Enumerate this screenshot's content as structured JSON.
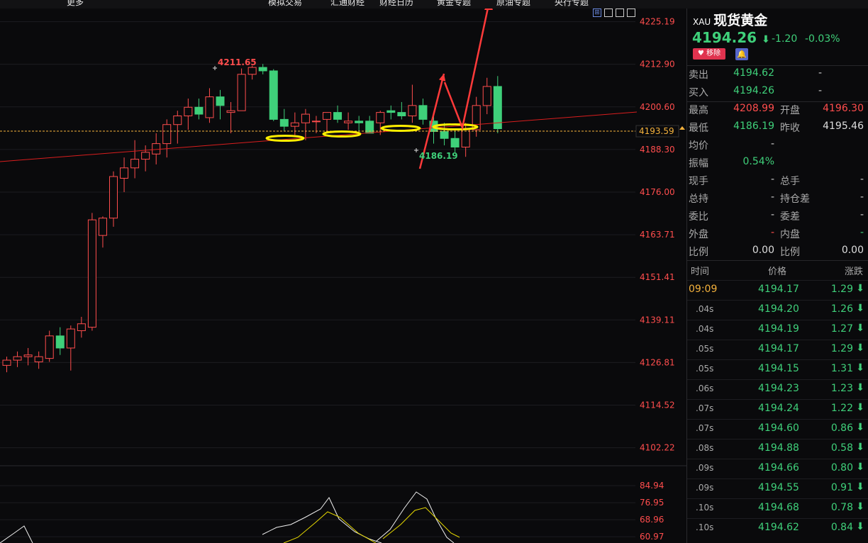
{
  "toolbar": {
    "items": [
      "更多",
      "模拟交易",
      "汇通财经",
      "财经日历",
      "黄金专题",
      "原油专题",
      "央行专题"
    ]
  },
  "chart": {
    "price_labels": [
      "4225.19",
      "4212.90",
      "4200.60",
      "4188.30",
      "4176.00",
      "4163.71",
      "4151.41",
      "4139.11",
      "4126.81",
      "4114.52",
      "4102.22"
    ],
    "current_price_tag": "4193.59",
    "high_label": "4211.65",
    "low_label": "4186.19",
    "indicator_labels": [
      "84.94",
      "76.95",
      "68.96",
      "60.97"
    ],
    "colors": {
      "up": "#ff4d4d",
      "down": "#3fd07a",
      "annotation": "#ffee00",
      "arrow": "#ff3a3a"
    }
  },
  "chart_data": {
    "type": "candlestick",
    "ylim": [
      4096,
      4229
    ],
    "candles": [
      {
        "o": 4126.0,
        "h": 4128.5,
        "l": 4124.0,
        "c": 4127.5
      },
      {
        "o": 4127.5,
        "h": 4130.0,
        "l": 4125.5,
        "c": 4128.5
      },
      {
        "o": 4128.5,
        "h": 4131.0,
        "l": 4126.0,
        "c": 4129.0
      },
      {
        "o": 4127.0,
        "h": 4130.0,
        "l": 4125.0,
        "c": 4128.5
      },
      {
        "o": 4128.0,
        "h": 4136.0,
        "l": 4127.0,
        "c": 4134.5
      },
      {
        "o": 4134.5,
        "h": 4137.0,
        "l": 4129.0,
        "c": 4131.0
      },
      {
        "o": 4131.0,
        "h": 4137.5,
        "l": 4124.5,
        "c": 4136.5
      },
      {
        "o": 4136.0,
        "h": 4140.0,
        "l": 4134.0,
        "c": 4138.0
      },
      {
        "o": 4137.0,
        "h": 4170.0,
        "l": 4136.0,
        "c": 4168.0
      },
      {
        "o": 4163.5,
        "h": 4169.0,
        "l": 4160.0,
        "c": 4168.5
      },
      {
        "o": 4168.5,
        "h": 4182.0,
        "l": 4166.0,
        "c": 4180.5
      },
      {
        "o": 4180.0,
        "h": 4186.0,
        "l": 4176.0,
        "c": 4183.0
      },
      {
        "o": 4183.0,
        "h": 4191.0,
        "l": 4180.0,
        "c": 4185.5
      },
      {
        "o": 4185.5,
        "h": 4189.5,
        "l": 4182.0,
        "c": 4187.5
      },
      {
        "o": 4187.0,
        "h": 4193.0,
        "l": 4184.0,
        "c": 4190.0
      },
      {
        "o": 4190.0,
        "h": 4197.0,
        "l": 4186.0,
        "c": 4195.5
      },
      {
        "o": 4195.5,
        "h": 4199.5,
        "l": 4190.0,
        "c": 4198.0
      },
      {
        "o": 4198.0,
        "h": 4203.0,
        "l": 4194.0,
        "c": 4200.5
      },
      {
        "o": 4200.5,
        "h": 4203.0,
        "l": 4197.0,
        "c": 4198.5
      },
      {
        "o": 4197.5,
        "h": 4206.0,
        "l": 4196.0,
        "c": 4203.5
      },
      {
        "o": 4203.5,
        "h": 4205.5,
        "l": 4197.0,
        "c": 4201.0
      },
      {
        "o": 4199.0,
        "h": 4202.0,
        "l": 4193.0,
        "c": 4199.5
      },
      {
        "o": 4199.5,
        "h": 4211.7,
        "l": 4200.0,
        "c": 4210.0
      },
      {
        "o": 4210.0,
        "h": 4212.5,
        "l": 4208.5,
        "c": 4212.0
      },
      {
        "o": 4212.0,
        "h": 4213.0,
        "l": 4210.0,
        "c": 4211.0
      },
      {
        "o": 4211.0,
        "h": 4211.5,
        "l": 4196.5,
        "c": 4197.0
      },
      {
        "o": 4197.0,
        "h": 4200.0,
        "l": 4193.5,
        "c": 4195.0
      },
      {
        "o": 4195.0,
        "h": 4199.0,
        "l": 4192.5,
        "c": 4196.0
      },
      {
        "o": 4196.0,
        "h": 4200.0,
        "l": 4191.0,
        "c": 4198.5
      },
      {
        "o": 4196.5,
        "h": 4198.0,
        "l": 4193.0,
        "c": 4196.5
      },
      {
        "o": 4197.0,
        "h": 4199.0,
        "l": 4193.5,
        "c": 4199.0
      },
      {
        "o": 4199.0,
        "h": 4201.0,
        "l": 4196.0,
        "c": 4197.0
      },
      {
        "o": 4196.0,
        "h": 4199.0,
        "l": 4194.0,
        "c": 4196.5
      },
      {
        "o": 4196.5,
        "h": 4198.0,
        "l": 4193.5,
        "c": 4196.0
      },
      {
        "o": 4196.5,
        "h": 4198.0,
        "l": 4193.5,
        "c": 4193.0
      },
      {
        "o": 4196.0,
        "h": 4199.5,
        "l": 4192.5,
        "c": 4199.0
      },
      {
        "o": 4199.5,
        "h": 4201.0,
        "l": 4197.0,
        "c": 4199.0
      },
      {
        "o": 4199.0,
        "h": 4202.0,
        "l": 4197.0,
        "c": 4198.0
      },
      {
        "o": 4198.0,
        "h": 4207.0,
        "l": 4196.0,
        "c": 4201.0
      },
      {
        "o": 4201.0,
        "h": 4203.0,
        "l": 4195.5,
        "c": 4197.0
      },
      {
        "o": 4196.5,
        "h": 4198.5,
        "l": 4190.0,
        "c": 4193.5
      },
      {
        "o": 4193.5,
        "h": 4196.0,
        "l": 4189.5,
        "c": 4191.5
      },
      {
        "o": 4191.5,
        "h": 4193.5,
        "l": 4187.5,
        "c": 4189.0
      },
      {
        "o": 4189.0,
        "h": 4196.0,
        "l": 4186.19,
        "c": 4194.0
      },
      {
        "o": 4194.0,
        "h": 4203.5,
        "l": 4192.0,
        "c": 4201.0
      },
      {
        "o": 4201.0,
        "h": 4209.0,
        "l": 4198.5,
        "c": 4206.5
      },
      {
        "o": 4206.5,
        "h": 4209.5,
        "l": 4193.0,
        "c": 4194.3
      }
    ],
    "indicator_ylim": [
      58,
      88
    ]
  },
  "panel": {
    "symbol": "XAU",
    "name": "现货黄金",
    "last": "4194.26",
    "change": "-1.20",
    "change_pct": "-0.03%",
    "remove_label": "移除",
    "rows": [
      {
        "l1": "卖出",
        "v1": "4194.62",
        "c1": "#3fd07a",
        "v2": "-",
        "c2": "#ccc"
      },
      {
        "l1": "买入",
        "v1": "4194.26",
        "c1": "#3fd07a",
        "v2": "-",
        "c2": "#ccc"
      }
    ],
    "stats": [
      {
        "l1": "最高",
        "v1": "4208.99",
        "c1": "#ff4d4d",
        "l2": "开盘",
        "v2": "4196.30",
        "c2": "#ff4d4d"
      },
      {
        "l1": "最低",
        "v1": "4186.19",
        "c1": "#3fd07a",
        "l2": "昨收",
        "v2": "4195.46",
        "c2": "#ddd"
      },
      {
        "l1": "均价",
        "v1": "-",
        "c1": "#ccc",
        "l2": "",
        "v2": "",
        "c2": "#ccc"
      },
      {
        "l1": "振幅",
        "v1": "0.54%",
        "c1": "#3fd07a",
        "l2": "",
        "v2": "",
        "c2": "#ccc"
      },
      {
        "l1": "现手",
        "v1": "-",
        "c1": "#ccc",
        "l2": "总手",
        "v2": "-",
        "c2": "#ccc"
      },
      {
        "l1": "总持",
        "v1": "-",
        "c1": "#ccc",
        "l2": "持仓差",
        "v2": "-",
        "c2": "#ccc"
      },
      {
        "l1": "委比",
        "v1": "-",
        "c1": "#ccc",
        "l2": "委差",
        "v2": "-",
        "c2": "#ccc"
      },
      {
        "l1": "外盘",
        "v1": "-",
        "c1": "#ff4d4d",
        "l2": "内盘",
        "v2": "-",
        "c2": "#3fd07a"
      },
      {
        "l1": "比例",
        "v1": "0.00",
        "c1": "#ddd",
        "l2": "比例",
        "v2": "0.00",
        "c2": "#ddd"
      }
    ],
    "tick_headers": {
      "time": "时间",
      "price": "价格",
      "change": "涨跌"
    },
    "ticks": [
      {
        "t": "09:09",
        "p": "4194.17",
        "c": "1.29"
      },
      {
        "t": ".04s",
        "p": "4194.20",
        "c": "1.26"
      },
      {
        "t": ".04s",
        "p": "4194.19",
        "c": "1.27"
      },
      {
        "t": ".05s",
        "p": "4194.17",
        "c": "1.29"
      },
      {
        "t": ".05s",
        "p": "4194.15",
        "c": "1.31"
      },
      {
        "t": ".06s",
        "p": "4194.23",
        "c": "1.23"
      },
      {
        "t": ".07s",
        "p": "4194.24",
        "c": "1.22"
      },
      {
        "t": ".07s",
        "p": "4194.60",
        "c": "0.86"
      },
      {
        "t": ".08s",
        "p": "4194.88",
        "c": "0.58"
      },
      {
        "t": ".09s",
        "p": "4194.66",
        "c": "0.80"
      },
      {
        "t": ".09s",
        "p": "4194.55",
        "c": "0.91"
      },
      {
        "t": ".10s",
        "p": "4194.68",
        "c": "0.78"
      },
      {
        "t": ".10s",
        "p": "4194.62",
        "c": "0.84"
      }
    ]
  }
}
